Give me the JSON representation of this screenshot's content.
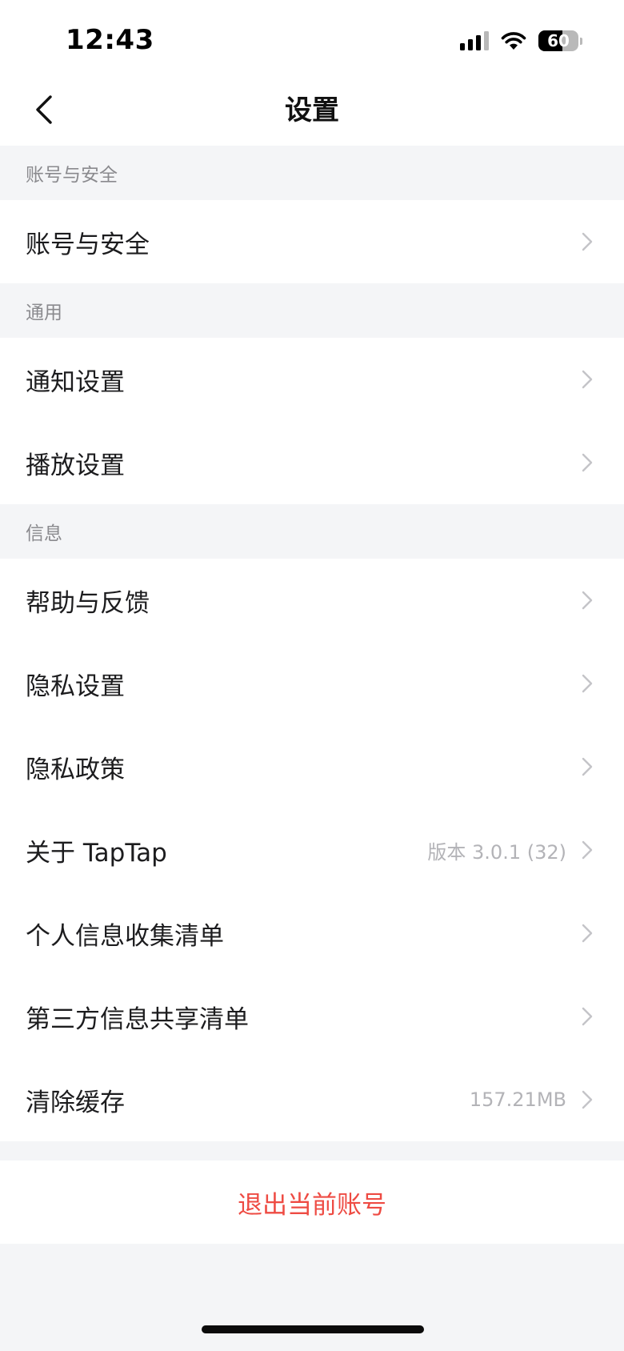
{
  "status_bar": {
    "time": "12:43",
    "battery": "60",
    "battery_level": 0.6
  },
  "nav": {
    "title": "设置",
    "back_icon": "chevron-left-icon"
  },
  "sections": [
    {
      "header": "账号与安全",
      "items": [
        {
          "label": "账号与安全",
          "value": ""
        }
      ]
    },
    {
      "header": "通用",
      "items": [
        {
          "label": "通知设置",
          "value": ""
        },
        {
          "label": "播放设置",
          "value": ""
        }
      ]
    },
    {
      "header": "信息",
      "items": [
        {
          "label": "帮助与反馈",
          "value": ""
        },
        {
          "label": "隐私设置",
          "value": ""
        },
        {
          "label": "隐私政策",
          "value": ""
        },
        {
          "label": "关于 TapTap",
          "value": "版本 3.0.1 (32)"
        },
        {
          "label": "个人信息收集清单",
          "value": ""
        },
        {
          "label": "第三方信息共享清单",
          "value": ""
        },
        {
          "label": "清除缓存",
          "value": "157.21MB"
        }
      ]
    }
  ],
  "logout": {
    "label": "退出当前账号"
  },
  "colors": {
    "background": "#f4f5f7",
    "danger": "#ee4b43",
    "secondary_text": "#8a8a8e",
    "value_text": "#b3b3b7"
  }
}
